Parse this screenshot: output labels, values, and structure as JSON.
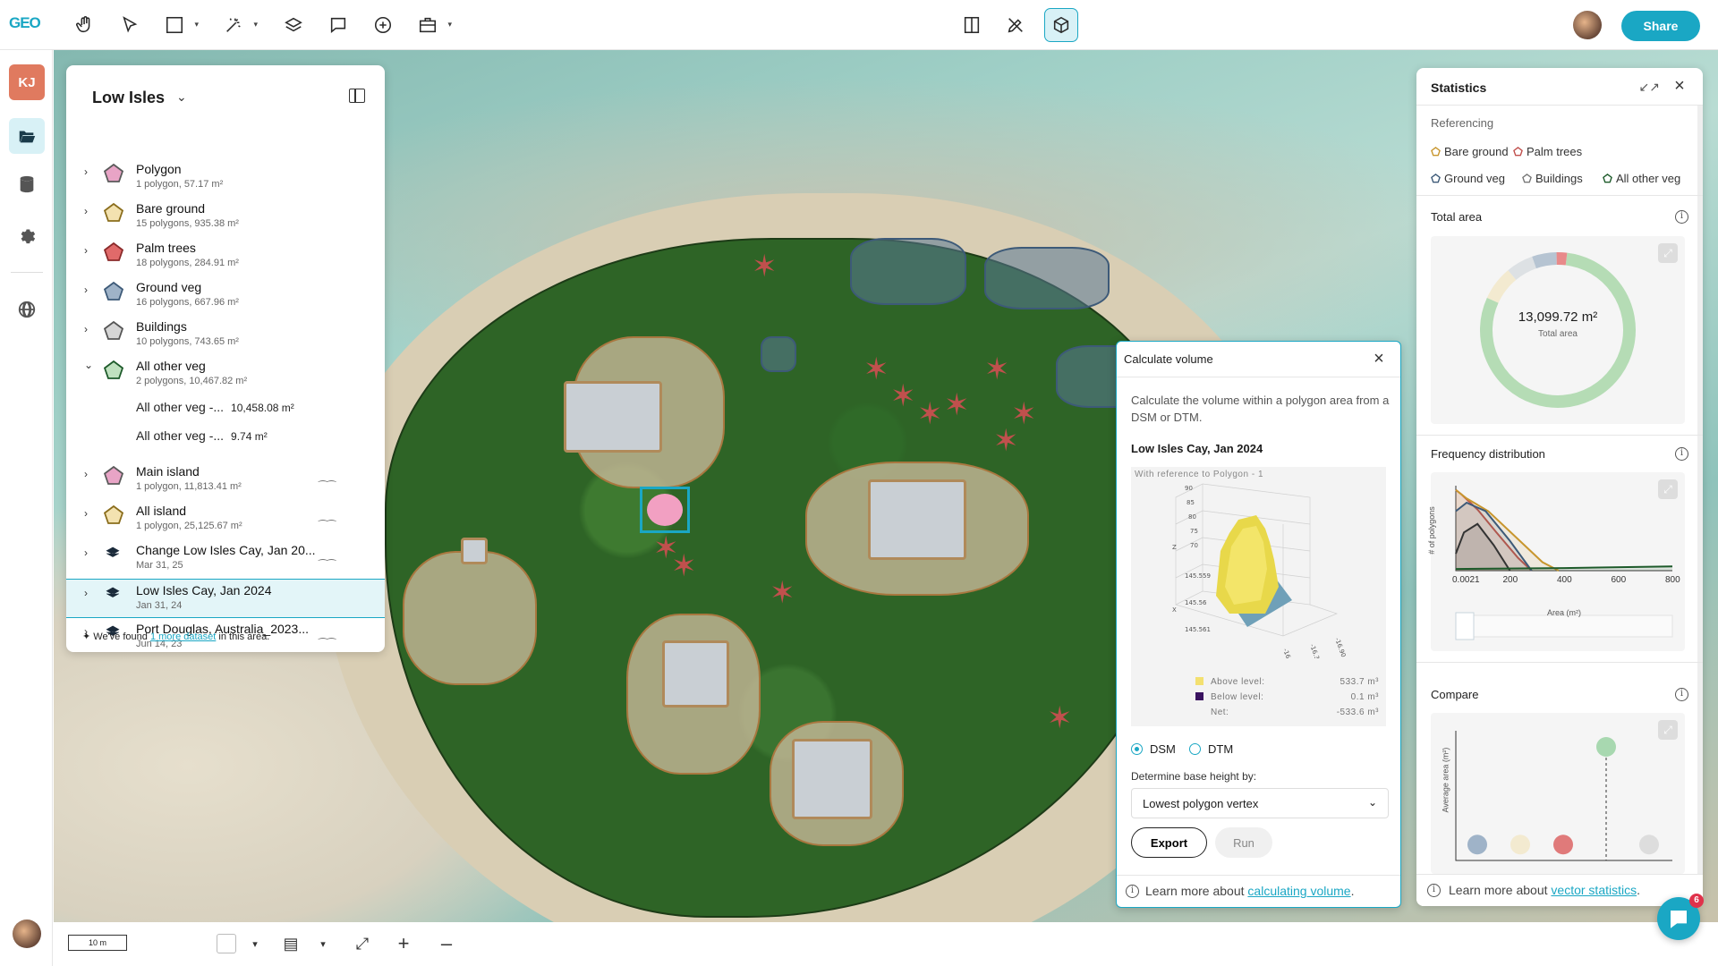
{
  "app": {
    "logo": "GEO",
    "share_label": "Share",
    "user_initials": "KJ"
  },
  "toolbar": {
    "tools": [
      "hand-icon",
      "pointer-icon",
      "rectangle-icon",
      "magic-wand-icon",
      "layers-add-icon",
      "comment-icon",
      "add-circle-icon",
      "toolbox-icon"
    ],
    "center": [
      "split-view-icon",
      "no-edit-icon",
      "cube-3d-icon"
    ]
  },
  "layers": {
    "title": "Low Isles",
    "items": [
      {
        "name": "Polygon",
        "sub": "1 polygon, 57.17 m²",
        "color": "#e8a4c6",
        "stroke": "#5a5a5a"
      },
      {
        "name": "Bare ground",
        "sub": "15 polygons, 935.38 m²",
        "color": "#f3e2b0",
        "stroke": "#8a6d1c"
      },
      {
        "name": "Palm trees",
        "sub": "18 polygons, 284.91 m²",
        "color": "#e06a6a",
        "stroke": "#8a2a2a"
      },
      {
        "name": "Ground veg",
        "sub": "16 polygons, 667.96 m²",
        "color": "#9fb3c8",
        "stroke": "#3d5a78"
      },
      {
        "name": "Buildings",
        "sub": "10 polygons, 743.65 m²",
        "color": "#d6d6d6",
        "stroke": "#555555"
      },
      {
        "name": "All other veg",
        "sub": "2 polygons, 10,467.82 m²",
        "color": "#bfe1bf",
        "stroke": "#1d5a2a"
      }
    ],
    "subrows": [
      {
        "name": "All other veg -...",
        "value": "10,458.08 m²"
      },
      {
        "name": "All other veg -...",
        "value": "9.74 m²"
      }
    ],
    "hidden_items": [
      {
        "name": "Main island",
        "sub": "1 polygon, 11,813.41 m²",
        "color": "#e8a4c6",
        "stroke": "#5a5a5a"
      },
      {
        "name": "All island",
        "sub": "1 polygon, 25,125.67 m²",
        "color": "#f3e2b0",
        "stroke": "#8a6d1c"
      }
    ],
    "datasets": [
      {
        "name": "Change Low Isles Cay, Jan 20...",
        "sub": "Mar 31, 25"
      },
      {
        "name": "Low Isles Cay, Jan 2024",
        "sub": "Jan 31, 24"
      },
      {
        "name": "Port Douglas, Australia_2023...",
        "sub": "Jun 14, 23"
      }
    ],
    "found_prefix": "We've found",
    "found_link": "1 more dataset",
    "found_suffix": "in this area."
  },
  "calc": {
    "title": "Calculate volume",
    "description": "Calculate the volume within a polygon area from a DSM or DTM.",
    "dataset": "Low Isles Cay, Jan 2024",
    "reference": "With reference to Polygon - 1",
    "axis_z": "Z",
    "axis_x": "X",
    "z_ticks": [
      "90",
      "85",
      "80",
      "75",
      "70"
    ],
    "x_ticks": [
      "145.559",
      "145.56",
      "145.561"
    ],
    "y_ticks": [
      "-16",
      "-16.3",
      "-16.90"
    ],
    "legend": [
      {
        "label": "Above level:",
        "value": "533.7 m³",
        "color": "#f3e070"
      },
      {
        "label": "Below level:",
        "value": "0.1 m³",
        "color": "#3a1360"
      },
      {
        "label": "Net:",
        "value": "-533.6 m³",
        "color": ""
      }
    ],
    "source_options": [
      {
        "label": "DSM",
        "selected": true
      },
      {
        "label": "DTM",
        "selected": false
      }
    ],
    "base_label": "Determine base height by:",
    "base_value": "Lowest polygon vertex",
    "export_label": "Export",
    "run_label": "Run",
    "footer_prefix": "Learn more about",
    "footer_link": "calculating volume",
    "footer_suffix": "."
  },
  "stats": {
    "title": "Statistics",
    "referencing_label": "Referencing",
    "referencing": [
      {
        "label": "Bare ground",
        "color": "#c8962e"
      },
      {
        "label": "Palm trees",
        "color": "#c0504d"
      },
      {
        "label": "Ground veg",
        "color": "#3d5a78"
      },
      {
        "label": "Buildings",
        "color": "#777777"
      },
      {
        "label": "All other veg",
        "color": "#1d5a2a"
      }
    ],
    "total_area_title": "Total area",
    "total_area_value": "13,099.72 m²",
    "total_area_caption": "Total area",
    "freq_title": "Frequency distribution",
    "freq_ylabel": "# of polygons",
    "freq_xlabel": "Area (m²)",
    "freq_xticks": [
      "0.0021",
      "200",
      "400",
      "600",
      "800"
    ],
    "compare_title": "Compare",
    "compare_ylabel": "Average area (m²)",
    "footer_prefix": "Learn more about",
    "footer_link": "vector statistics",
    "footer_suffix": "."
  },
  "map": {
    "scale_label": "10 m"
  },
  "chat": {
    "badge": "6"
  },
  "chart_data": [
    {
      "type": "pie",
      "title": "Total area",
      "labels": [
        "All other veg",
        "Bare ground",
        "Buildings",
        "Ground veg",
        "Palm trees"
      ],
      "values": [
        10467.82,
        935.38,
        743.65,
        667.96,
        284.91
      ],
      "colors": [
        "#b5dcb5",
        "#f3ead0",
        "#dde1e4",
        "#b6c4d2",
        "#e88a8a"
      ]
    },
    {
      "type": "line",
      "title": "Frequency distribution",
      "xlabel": "Area (m²)",
      "ylabel": "# of polygons",
      "xlim": [
        0,
        800
      ],
      "series": [
        {
          "name": "Palm trees",
          "x": [
            0,
            20,
            80,
            150,
            230,
            280
          ],
          "y": [
            0.95,
            0.9,
            0.72,
            0.45,
            0.15,
            0
          ],
          "color": "#c0504d"
        },
        {
          "name": "Bare ground",
          "x": [
            0,
            40,
            120,
            220,
            320,
            380
          ],
          "y": [
            0.95,
            0.85,
            0.7,
            0.4,
            0.1,
            0
          ],
          "color": "#c8962e"
        },
        {
          "name": "Ground veg",
          "x": [
            0,
            40,
            110,
            200,
            280
          ],
          "y": [
            0.7,
            0.8,
            0.7,
            0.35,
            0
          ],
          "color": "#3d5a78"
        },
        {
          "name": "Buildings",
          "x": [
            0,
            30,
            80,
            140,
            200
          ],
          "y": [
            0.2,
            0.45,
            0.55,
            0.3,
            0
          ],
          "color": "#333333"
        },
        {
          "name": "All other veg",
          "x": [
            0,
            400,
            800
          ],
          "y": [
            0.02,
            0.03,
            0.05
          ],
          "color": "#1d5a2a"
        }
      ]
    },
    {
      "type": "scatter",
      "title": "Compare",
      "ylabel": "Average area (m²)",
      "series": [
        {
          "name": "Ground veg",
          "value": 0.05,
          "color": "#9fb3c8"
        },
        {
          "name": "Bare ground",
          "value": 0.05,
          "color": "#f3ead0"
        },
        {
          "name": "Palm trees",
          "value": 0.05,
          "color": "#e07a7a"
        },
        {
          "name": "All other veg",
          "value": 1.0,
          "color": "#a8d8b0"
        },
        {
          "name": "Buildings",
          "value": 0.05,
          "color": "#dddddd"
        }
      ]
    }
  ]
}
